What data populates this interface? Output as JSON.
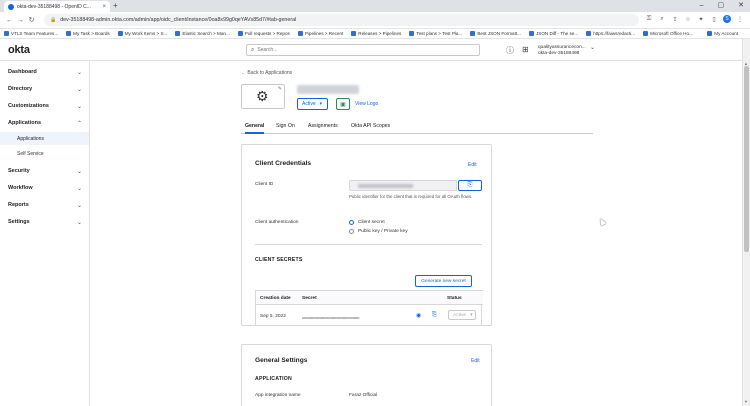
{
  "browser": {
    "tab_title": "okta-dev-35188498 - OpenID C...",
    "tab_close": "×",
    "new_tab": "+",
    "url": "dev-35188498-admin.okta.com/admin/app/oidc_client/instance/0oa8x99g0qeYAVs85d7/#tab-general",
    "win_min": "–",
    "win_max": "▢",
    "win_close": "✕",
    "nav_back": "←",
    "nav_forward": "→",
    "nav_reload": "↻",
    "profile_initial": "S",
    "bookmarks": [
      "VTLS Team Features...",
      "My Task > Boards",
      "My Work Items > S...",
      "Elastic Search > Man...",
      "Pull requests > Repos",
      "Pipelines > Recent",
      "Releases > Pipelines",
      "Test plans > Test Pla...",
      "Best JSON Formatt...",
      "JSON Diff - The se...",
      "https://faiwsredacti...",
      "Microsoft Office Ho..."
    ],
    "bookmark_right": "My Account"
  },
  "header": {
    "logo": "okta",
    "search_placeholder": "Search...",
    "user_name": "qualityassurancecon...",
    "user_org": "okta-dev-35188498"
  },
  "sidebar": {
    "items": [
      {
        "label": "Dashboard"
      },
      {
        "label": "Directory"
      },
      {
        "label": "Customizations"
      },
      {
        "label": "Applications"
      },
      {
        "label": "Security"
      },
      {
        "label": "Workflow"
      },
      {
        "label": "Reports"
      },
      {
        "label": "Settings"
      }
    ],
    "sub_items": [
      {
        "label": "Applications"
      },
      {
        "label": "Self Service"
      }
    ]
  },
  "app": {
    "back_link": "← Back to Applications",
    "status": "Active",
    "view_logo": "View Logo",
    "tabs": [
      "General",
      "Sign On",
      "Assignments",
      "Okta API Scopes"
    ]
  },
  "credentials": {
    "title": "Client Credentials",
    "edit": "Edit",
    "client_id_label": "Client ID",
    "client_id_help": "Public identifier for the client that is required for all OAuth flows.",
    "auth_label": "Client authentication",
    "auth_options": [
      "Client secret",
      "Public key / Private key"
    ],
    "secrets_title": "CLIENT SECRETS",
    "generate_button": "Generate new secret",
    "columns": [
      "Creation date",
      "Secret",
      "Status"
    ],
    "rows": [
      {
        "date": "Sep 5, 2022",
        "secret": "••••••••••••••••••••••••••••••••••••••••••••••••••••",
        "status": "Active"
      }
    ]
  },
  "general": {
    "title": "General Settings",
    "edit": "Edit",
    "section": "APPLICATION",
    "name_label": "App integration name",
    "name_value": "Faraz Official"
  }
}
